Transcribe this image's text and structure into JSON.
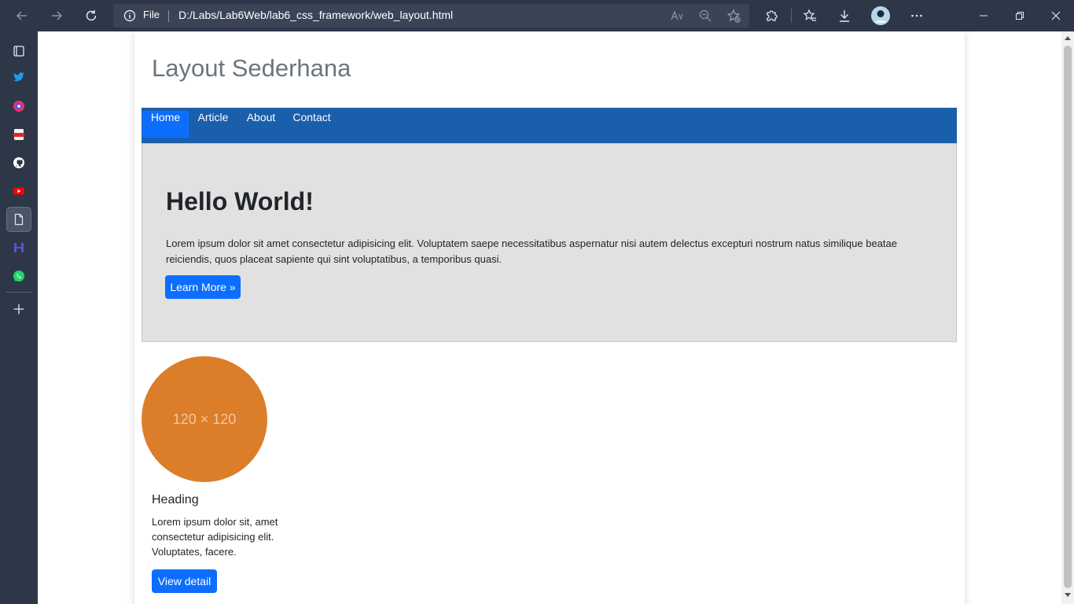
{
  "browser": {
    "address_prefix": "File",
    "url": "D:/Labs/Lab6Web/lab6_css_framework/web_layout.html"
  },
  "site": {
    "title": "Layout Sederhana",
    "nav": [
      {
        "label": "Home",
        "active": true
      },
      {
        "label": "Article"
      },
      {
        "label": "About"
      },
      {
        "label": "Contact"
      }
    ]
  },
  "hero": {
    "title": "Hello World!",
    "text": "Lorem ipsum dolor sit amet consectetur adipisicing elit. Voluptatem saepe necessitatibus aspernatur nisi autem delectus excepturi nostrum natus similique beatae reiciendis, quos placeat sapiente qui sint voluptatibus, a temporibus quasi.",
    "button": "Learn More »"
  },
  "card": {
    "image_label": "120 × 120",
    "image_color": "#dc7d2a",
    "heading": "Heading",
    "text": "Lorem ipsum dolor sit, amet consectetur adipisicing elit. Voluptates, facere.",
    "button": "View detail"
  },
  "colors": {
    "navbar": "#1a5fac",
    "primary": "#0d6efd",
    "hero_bg": "#e1e1e1",
    "browser_chrome": "#2d3748"
  },
  "icons": {
    "sidebar": [
      "collections-icon",
      "twitter-icon",
      "maps-icon",
      "pdf-icon",
      "github-icon",
      "youtube-icon",
      "document-icon",
      "app-icon",
      "whatsapp-icon",
      "add-icon"
    ]
  }
}
